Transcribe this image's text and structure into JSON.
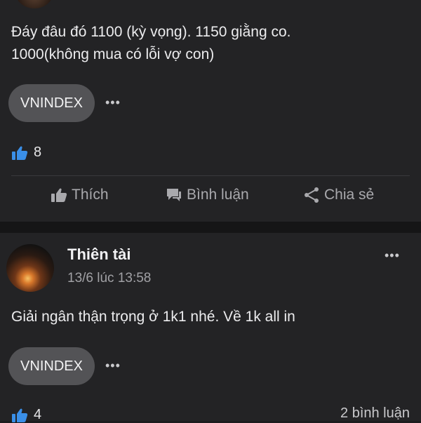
{
  "posts": [
    {
      "text": "Đáy đâu đó 1100 (kỳ vọng). 1150 giằng co.\n1000(không mua có lỗi vợ con)",
      "tag": "VNINDEX",
      "more": "•••",
      "like_count": "8",
      "actions": {
        "like": "Thích",
        "comment": "Bình luận",
        "share": "Chia sẻ"
      }
    },
    {
      "author": "Thiên tài",
      "timestamp": "13/6 lúc 13:58",
      "text": "Giải ngân thận trọng ở 1k1 nhé. Về 1k all in",
      "tag": "VNINDEX",
      "more": "•••",
      "header_more": "•••",
      "like_count": "4",
      "comment_count": "2 bình luận"
    }
  ],
  "colors": {
    "accent": "#3a8fe8",
    "background": "#1c1c1e",
    "card": "#232325",
    "chip": "#535356"
  },
  "icons": {
    "like": "thumbs-up-icon",
    "comment": "chat-bubble-icon",
    "share": "share-icon",
    "more": "more-dots-icon"
  }
}
